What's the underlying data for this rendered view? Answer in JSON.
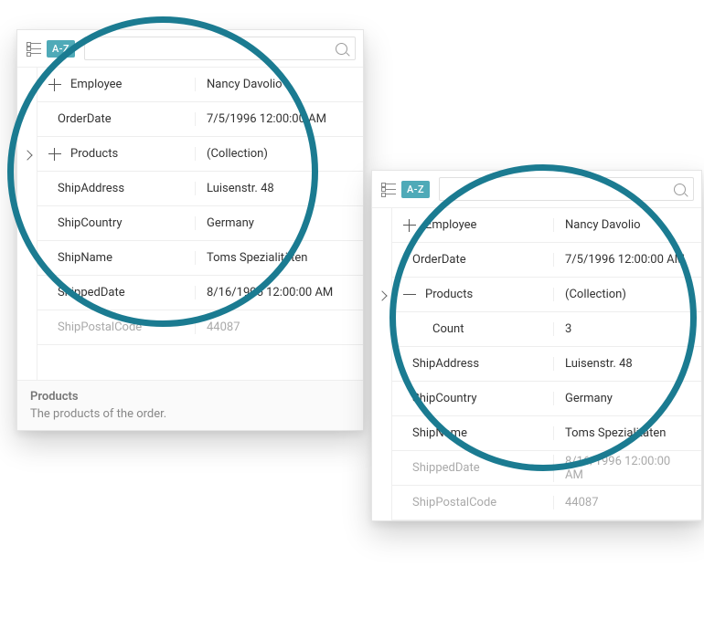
{
  "toolbar": {
    "sort_label": "A-Z",
    "search_placeholder": ""
  },
  "panel1": {
    "rows": [
      {
        "key": "Employee",
        "value": "Nancy Davolio",
        "expandable": true,
        "state": "plus",
        "muted": false
      },
      {
        "key": "OrderDate",
        "value": "7/5/1996 12:00:00 AM",
        "expandable": false,
        "state": "",
        "muted": false
      },
      {
        "key": "Products",
        "value": "(Collection)",
        "expandable": true,
        "state": "plus",
        "muted": false
      },
      {
        "key": "ShipAddress",
        "value": "Luisenstr. 48",
        "expandable": false,
        "state": "",
        "muted": false
      },
      {
        "key": "ShipCountry",
        "value": "Germany",
        "expandable": false,
        "state": "",
        "muted": false
      },
      {
        "key": "ShipName",
        "value": "Toms Spezialitäten",
        "expandable": false,
        "state": "",
        "muted": false
      },
      {
        "key": "ShippedDate",
        "value": "8/16/1996 12:00:00 AM",
        "expandable": false,
        "state": "",
        "muted": false
      },
      {
        "key": "ShipPostalCode",
        "value": "44087",
        "expandable": false,
        "state": "",
        "muted": true
      }
    ]
  },
  "panel2": {
    "rows": [
      {
        "key": "Employee",
        "value": "Nancy Davolio",
        "expandable": true,
        "state": "plus",
        "indent": false,
        "muted": false
      },
      {
        "key": "OrderDate",
        "value": "7/5/1996 12:00:00 AM",
        "expandable": false,
        "state": "",
        "indent": false,
        "muted": false
      },
      {
        "key": "Products",
        "value": "(Collection)",
        "expandable": true,
        "state": "minus",
        "indent": false,
        "muted": false
      },
      {
        "key": "Count",
        "value": "3",
        "expandable": false,
        "state": "",
        "indent": true,
        "muted": false
      },
      {
        "key": "ShipAddress",
        "value": "Luisenstr. 48",
        "expandable": false,
        "state": "",
        "indent": false,
        "muted": false
      },
      {
        "key": "ShipCountry",
        "value": "Germany",
        "expandable": false,
        "state": "",
        "indent": false,
        "muted": false
      },
      {
        "key": "ShipName",
        "value": "Toms Spezialitäten",
        "expandable": false,
        "state": "",
        "indent": false,
        "muted": false
      },
      {
        "key": "ShippedDate",
        "value": "8/16/1996 12:00:00 AM",
        "expandable": false,
        "state": "",
        "indent": false,
        "muted": true
      },
      {
        "key": "ShipPostalCode",
        "value": "44087",
        "expandable": false,
        "state": "",
        "indent": false,
        "muted": true
      }
    ]
  },
  "description": {
    "title": "Products",
    "body": "The products of the order."
  }
}
